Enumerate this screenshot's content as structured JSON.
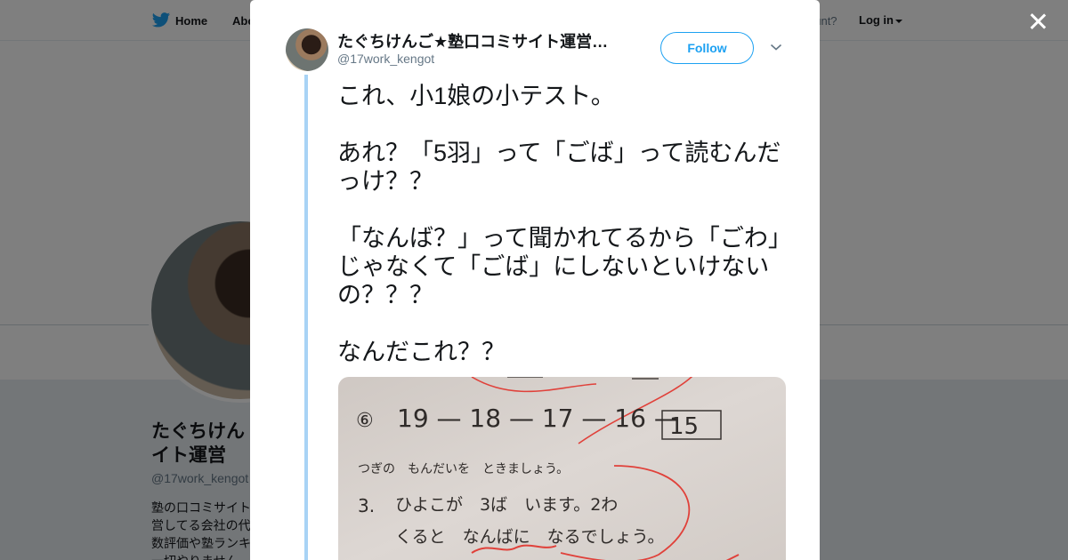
{
  "nav": {
    "home_label": "Home",
    "about_label": "Abo",
    "account_prompt": "ccount?",
    "login_label": "Log in"
  },
  "profile": {
    "name": "たぐちけん ごサイト運営",
    "handle": "@17work_kengot",
    "bio": "塾の口コミサイト営してる会社の代数評価や塾ランキ一切やりません"
  },
  "tweet": {
    "author_name": "たぐちけんご★塾口コミサイト運営…",
    "author_handle": "@17work_kengot",
    "follow_label": "Follow",
    "text": "これ、小1娘の小テスト。\n\nあれ？「5羽」って「ごば」って読むんだっけ？？\n\n「なんば？」って聞かれてるから「ごわ」じゃなくて「ごば」にしないといけないの？？？\n\nなんだこれ？？"
  },
  "photo": {
    "problem_number": "⑥",
    "sequence": "19 — 18 — 17 — 16 —",
    "answer": "15",
    "instruction": "つぎの　もんだいを　ときましょう。",
    "q_number": "3.",
    "q_line1": "ひよこが　3ば　います。2わ",
    "q_line2": "くると　なんばに　なるでしょう。"
  },
  "colors": {
    "accent": "#1da1f2",
    "thread": "#a8d3f5",
    "overlay": "rgba(0,0,0,0.5)",
    "paper": "#d9d3cf",
    "red_ink": "#e0413a"
  },
  "icons": {
    "nav_logo": "bird-icon",
    "close": "close-icon",
    "more": "chevron-down-icon"
  }
}
